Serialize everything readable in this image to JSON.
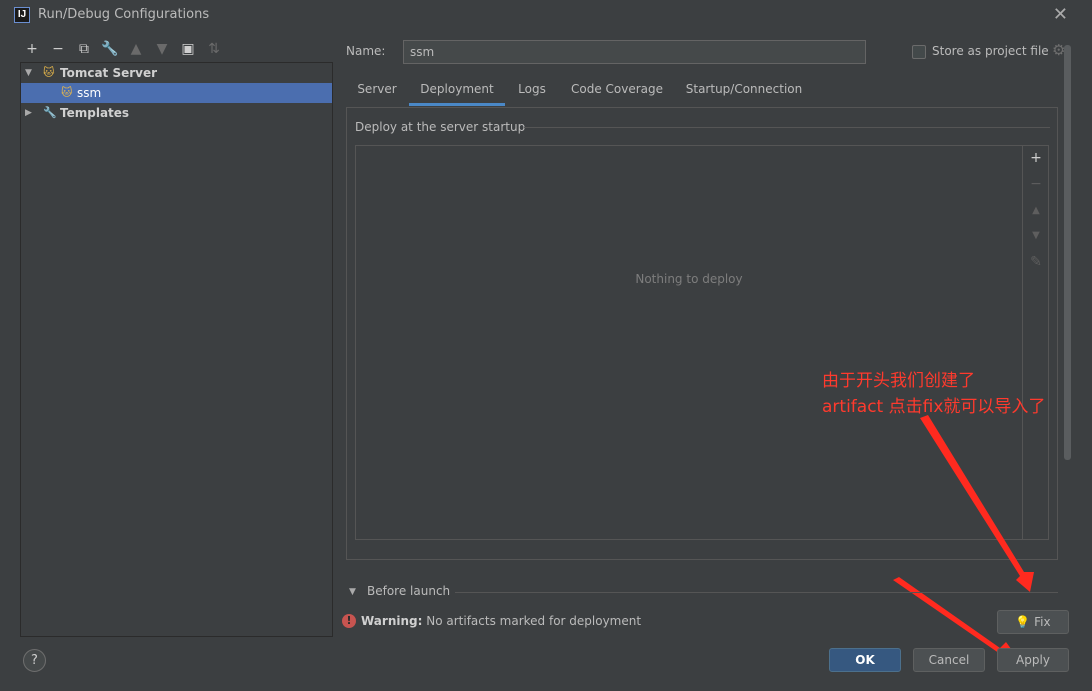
{
  "window": {
    "title": "Run/Debug Configurations",
    "app_icon_text": "IJ"
  },
  "toolbar": {
    "add": "+",
    "remove": "−",
    "copy": "⧉",
    "edit": "🔧",
    "up": "▲",
    "down": "▼",
    "folder": "▣",
    "sort": "⇅"
  },
  "tree": {
    "group_label": "Tomcat Server",
    "config_label": "ssm",
    "templates_label": "Templates"
  },
  "form": {
    "name_label": "Name:",
    "name_value": "ssm",
    "store_label": "Store as project file"
  },
  "tabs": [
    "Server",
    "Deployment",
    "Logs",
    "Code Coverage",
    "Startup/Connection"
  ],
  "active_tab": "Deployment",
  "deploy": {
    "section_title": "Deploy at the server startup",
    "empty_text": "Nothing to deploy"
  },
  "annotation": {
    "line1": "由于开头我们创建了",
    "line2": "artifact 点击fix就可以导入了",
    "color": "#ff3a2d"
  },
  "before_launch": {
    "label": "Before launch"
  },
  "warning": {
    "strong": "Warning:",
    "text": "No artifacts marked for deployment"
  },
  "buttons": {
    "fix": "Fix",
    "ok": "OK",
    "cancel": "Cancel",
    "apply": "Apply",
    "help": "?"
  }
}
